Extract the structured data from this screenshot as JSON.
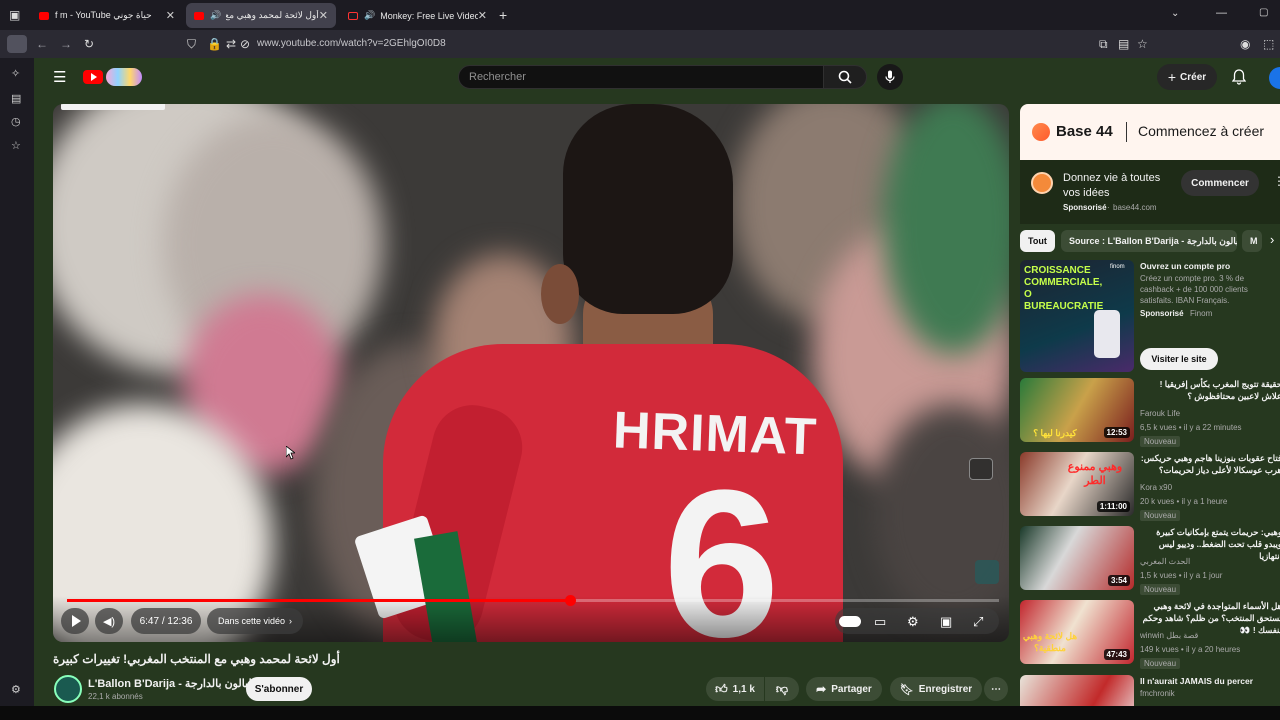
{
  "browser": {
    "tabs": [
      {
        "title": "حياة جوني f m - YouTube",
        "active": false
      },
      {
        "title": "أول لائحة لمحمد وهبي مع ا",
        "active": true
      },
      {
        "title": "Monkey: Free Live Video Ch",
        "active": false
      }
    ],
    "url": "www.youtube.com/watch?v=2GEhlgOI0D8"
  },
  "yt": {
    "search_placeholder": "Rechercher",
    "create_label": "Créer",
    "brand_color": "#ff0000"
  },
  "video": {
    "jersey_name": "HRIMAT",
    "jersey_number": "6",
    "time": "6:47 / 12:36",
    "chapter_label": "Dans cette vidéo",
    "progress": 0.54,
    "title": "أول لائحة لمحمد وهبي مع المنتخب المغربي! تغييرات كبيرة",
    "channel_name": "L'Ballon B'Darija - البالون بالدارجة",
    "channel_subs": "22,1 k abonnés",
    "subscribe_label": "S'abonner",
    "likes": "1,1 k",
    "share_label": "Partager",
    "save_label": "Enregistrer"
  },
  "ad": {
    "banner_brand": "Base 44",
    "banner_tagline": "Commencez à créer",
    "headline_line1": "Donnez vie à toutes",
    "headline_line2": "vos idées",
    "sponsored": "Sponsorisé",
    "domain": "base44.com",
    "cta": "Commencer"
  },
  "chips": [
    "Tout",
    "Source : L'Ballon B'Darija - البالون بالدارجة",
    "M"
  ],
  "recs": [
    {
      "thumb_text": "CROISSANCE COMMERCIALE, O BUREAUCRATIE",
      "thumb_brand": "finom",
      "title": "Ouvrez un compte pro",
      "desc": "Créez un compte pro. 3 % de cashback + de 100 000 clients satisfaits. IBAN Français.",
      "sponsored": "Sponsorisé",
      "advertiser": "Finom",
      "cta": "Visiter le site"
    },
    {
      "title": "حقيقة تتويج المغرب بكأس إفريقيا ! علاش لاعبين محتافظوش ؟",
      "channel": "Farouk Life",
      "meta": "6,5 k vues • il y a 22 minutes",
      "badge": "Nouveau",
      "duration": "12:53",
      "thumb_caption": "كيدرنا ليها ؟"
    },
    {
      "title": "فتاح عقوبات بنوزينا هاجم وهبي حريكس: هرب عوسكالا لأعلى دياز لحريمات؟",
      "channel": "Kora x90",
      "meta": "20 k vues • il y a 1 heure",
      "badge": "Nouveau",
      "duration": "1:11:00",
      "thumb_caption": "وهبي ممنوع الطر"
    },
    {
      "title": "وهبي: حريمات يتمتع بإمكانيات كبيرة ويبدو قلب تحت الضغط.. ودييو ليس انتهازيا",
      "channel": "الحدث المغربي",
      "meta": "1,5 k vues • il y a 1 jour",
      "badge": "Nouveau",
      "duration": "3:54",
      "thumb_caption": ""
    },
    {
      "title": "هل الأسماء المتواجدة في لائحة وهبي تستحق المنتخب؟ من ظلم؟ شاهد وحكم بنفسك ! 👀",
      "channel": "winwin قصة بطل",
      "meta": "149 k vues • il y a 20 heures",
      "badge": "Nouveau",
      "duration": "47:43",
      "thumb_caption": "هل لائحة وهبي منطقية؟"
    },
    {
      "title": "Il n'aurait JAMAIS du percer",
      "channel": "fmchronik",
      "meta": "",
      "badge": "",
      "duration": "",
      "thumb_caption": ""
    }
  ]
}
